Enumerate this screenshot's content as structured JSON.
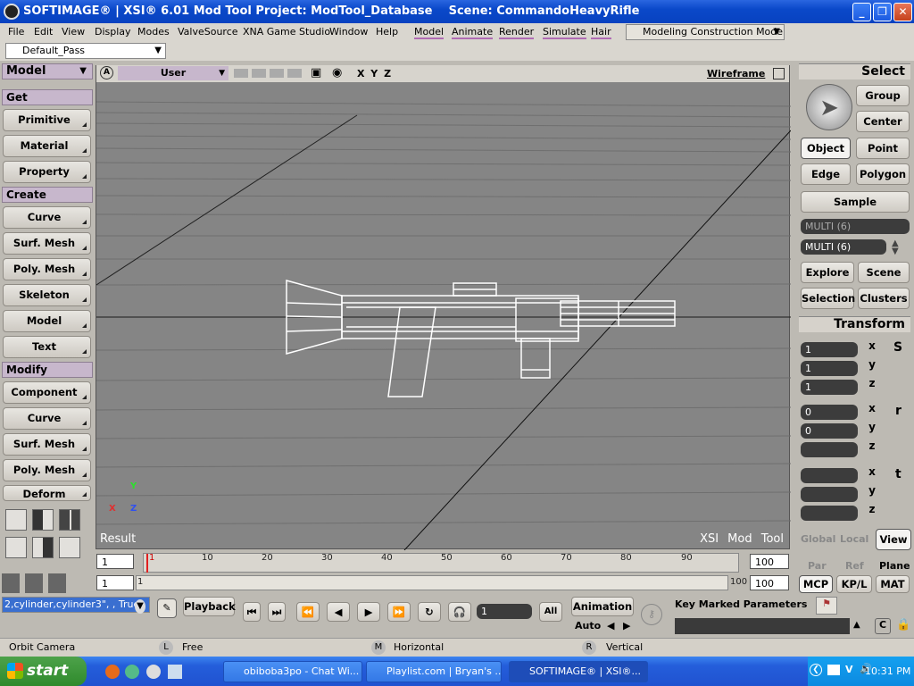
{
  "titlebar": {
    "title": "SOFTIMAGE® | XSI® 6.01 Mod Tool Project: ModTool_Database    Scene: CommandoHeavyRifle"
  },
  "menus": [
    "File",
    "Edit",
    "View",
    "Display",
    "Modes",
    "ValveSource",
    "XNA Game Studio",
    "Window",
    "Help"
  ],
  "modules": [
    "Model",
    "Animate",
    "Render",
    "Simulate",
    "Hair"
  ],
  "mode_select": "Modeling Construction Mode",
  "pass": "Default_Pass",
  "left": {
    "panel": "Model",
    "sections": {
      "get": "Get",
      "create": "Create",
      "modify": "Modify"
    },
    "get_items": [
      "Primitive",
      "Material",
      "Property"
    ],
    "create_items": [
      "Curve",
      "Surf. Mesh",
      "Poly. Mesh",
      "Skeleton",
      "Model",
      "Text"
    ],
    "modify_items": [
      "Component",
      "Curve",
      "Surf. Mesh",
      "Poly. Mesh",
      "Deform"
    ]
  },
  "viewport": {
    "camera": "User",
    "axes": "X Y Z",
    "display_mode": "Wireframe",
    "label_result": "Result",
    "watermark": "XSI Mod Tool",
    "badge": "A",
    "gizmo_x": "X",
    "gizmo_y": "Y",
    "gizmo_z": "Z"
  },
  "right": {
    "select_title": "Select",
    "sel_buttons": {
      "group": "Group",
      "center": "Center",
      "object": "Object",
      "point": "Point",
      "edge": "Edge",
      "polygon": "Polygon",
      "sample": "Sample"
    },
    "multi1": "MULTI (6)",
    "multi2": "MULTI (6)",
    "explore": "Explore",
    "scene": "Scene",
    "selection": "Selection",
    "clusters": "Clusters",
    "transform_title": "Transform",
    "scale": [
      "1",
      "1",
      "1"
    ],
    "rotate": [
      "0",
      "0",
      ""
    ],
    "translate": [
      "",
      "",
      ""
    ],
    "axis_labels": [
      "x",
      "y",
      "z"
    ],
    "s_label": "S",
    "r_label": "r",
    "t_label": "t",
    "ref_modes": [
      "Global",
      "Local",
      "View"
    ],
    "ref_modes2": [
      "Par",
      "Ref",
      "Plane"
    ],
    "tabs": [
      "MCP",
      "KP/L",
      "MAT"
    ]
  },
  "timeline": {
    "start": "1",
    "end": "100",
    "start2": "1",
    "end2": "100",
    "range_start": "1",
    "range_end": "100",
    "ticks": [
      "1",
      "10",
      "20",
      "30",
      "40",
      "50",
      "60",
      "70",
      "80",
      "90"
    ]
  },
  "cmd": {
    "script": "2,cylinder,cylinder3\", , True",
    "playback": "Playback",
    "frame": "1",
    "all": "All",
    "animation": "Animation",
    "auto": "Auto",
    "key_marked": "Key Marked Parameters"
  },
  "status": {
    "left": "Orbit Camera",
    "l_label": "L",
    "l_value": "Free",
    "m_label": "M",
    "m_value": "Horizontal",
    "r_label": "R",
    "r_value": "Vertical"
  },
  "taskbar": {
    "start": "start",
    "tasks": [
      "obiboba3po - Chat Wi...",
      "Playlist.com | Bryan's ...",
      "SOFTIMAGE® | XSI®..."
    ],
    "clock": "10:31 PM",
    "tray_v": "V"
  }
}
